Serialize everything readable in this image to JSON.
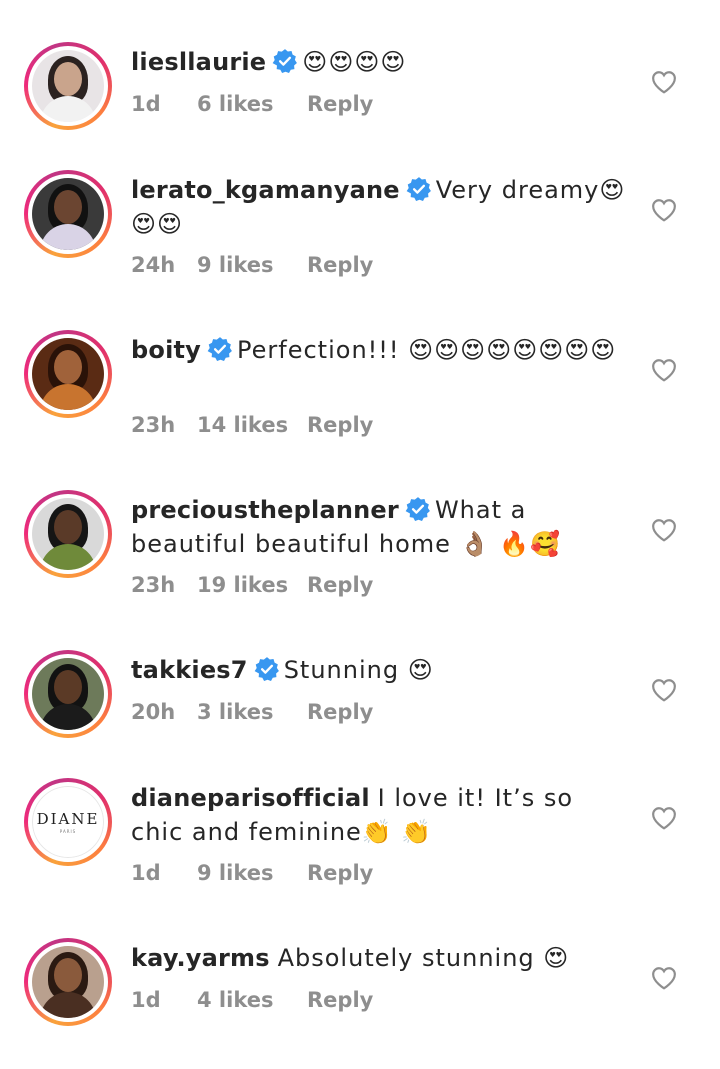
{
  "icons": {
    "verified": "verified-badge-icon",
    "like": "heart-outline-icon"
  },
  "colors": {
    "ring_gradient_start": "#f9a23c",
    "ring_gradient_end": "#c13584",
    "verified_blue": "#3897f0",
    "meta_gray": "#8e8e8e",
    "text": "#262626"
  },
  "comments": [
    {
      "username": "liesllaurie",
      "verified": true,
      "text": "😍😍😍😍",
      "time": "1d",
      "likes": "6 likes",
      "reply": "Reply"
    },
    {
      "username": "lerato_kgamanyane",
      "verified": true,
      "text": "Very dreamy😍😍😍",
      "time": "24h",
      "likes": "9 likes",
      "reply": "Reply"
    },
    {
      "username": "boity",
      "verified": true,
      "text": "Perfection!!! 😍😍😍😍😍😍😍😍",
      "time": "23h",
      "likes": "14 likes",
      "reply": "Reply"
    },
    {
      "username": "precioustheplanner",
      "verified": true,
      "text": "What a beautiful beautiful home 👌🏽 🔥🥰",
      "time": "23h",
      "likes": "19 likes",
      "reply": "Reply"
    },
    {
      "username": "takkies7",
      "verified": true,
      "text": "Stunning 😍",
      "time": "20h",
      "likes": "3 likes",
      "reply": "Reply"
    },
    {
      "username": "dianeparisofficial",
      "verified": false,
      "text": "I love it! It’s so chic and feminine👏 👏",
      "time": "1d",
      "likes": "9 likes",
      "reply": "Reply",
      "avatar_logo": "DIANE",
      "avatar_logo_sub": "PARIS"
    },
    {
      "username": "kay.yarms",
      "verified": false,
      "text": "Absolutely stunning 😍",
      "time": "1d",
      "likes": "4 likes",
      "reply": "Reply"
    }
  ]
}
